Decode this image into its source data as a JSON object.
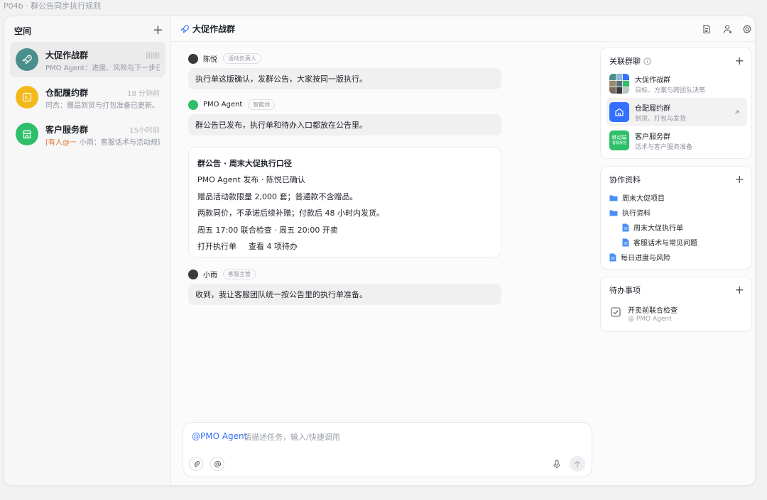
{
  "window_title": "P04b · 群公告同步执行规则",
  "sidebar": {
    "title": "空间",
    "add_label": "+",
    "spaces": [
      {
        "name": "大促作战群",
        "time": "刚刚",
        "preview": "PMO Agent：进度、风险与下一步已同…",
        "mention": "",
        "color": "#4a8f8c",
        "icon": "rocket-icon"
      },
      {
        "name": "仓配履约群",
        "time": "18 分钟前",
        "preview": "同杰：赠品到货与打包准备已更新。",
        "mention": "",
        "color": "#f3b91b",
        "icon": "terminal-icon"
      },
      {
        "name": "客户服务群",
        "time": "15小时前",
        "preview": "小雨：客服话术与活动规则…",
        "mention": "[有人@一",
        "color": "#2fbf6a",
        "icon": "store-icon"
      }
    ]
  },
  "chat": {
    "title": "大促作战群",
    "messages": [
      {
        "sender": "陈悦",
        "tag": "活动负责人",
        "text": "执行单这版确认，发群公告，大家按同一版执行。"
      },
      {
        "sender": "PMO Agent",
        "tag": "智能体",
        "text": "群公告已发布，执行单和待办入口都放在公告里。"
      },
      {
        "sender": "小雨",
        "tag": "客服主管",
        "text": "收到，我让客服团队统一按公告里的执行单准备。"
      }
    ],
    "announcement": {
      "title": "群公告 · 周末大促执行口径",
      "meta": "PMO Agent 发布 · 陈悦已确认",
      "lines": [
        "赠品活动款限量 2,000 套；普通款不含赠品。",
        "两款同价，不承诺后续补赠；付款后 48 小时内发货。",
        "周五 17:00 联合检查 · 周五 20:00 开卖"
      ],
      "action_open": "打开执行单",
      "action_todo": "查看 4 项待办"
    }
  },
  "composer": {
    "mention": "@PMO Agent",
    "placeholder": "请描述任务，输入/快捷调用"
  },
  "right": {
    "related": {
      "title": "关联群聊",
      "groups": [
        {
          "name": "大促作战群",
          "desc": "目标、方案与跨团队决策"
        },
        {
          "name": "仓配履约群",
          "desc": "到货、打包与发货"
        },
        {
          "name": "客户服务群",
          "desc": "话术与客户服务准备"
        }
      ],
      "thumb_text_1": "移动端",
      "thumb_text_2": "客服规范"
    },
    "docs": {
      "title": "协作资料",
      "items": [
        {
          "label": "周末大促项目",
          "type": "folder"
        },
        {
          "label": "执行资料",
          "type": "folder"
        },
        {
          "label": "周末大促执行单",
          "type": "file"
        },
        {
          "label": "客服话术与常见问题",
          "type": "file"
        },
        {
          "label": "每日进度与风险",
          "type": "file"
        }
      ]
    },
    "todo": {
      "title": "待办事项",
      "item": "开卖前联合检查",
      "assignee": "@ PMO Agent"
    }
  },
  "colors": {
    "accent": "#3370ff",
    "mention": "#e0732a",
    "agent_dot": "#2fbf6a"
  }
}
